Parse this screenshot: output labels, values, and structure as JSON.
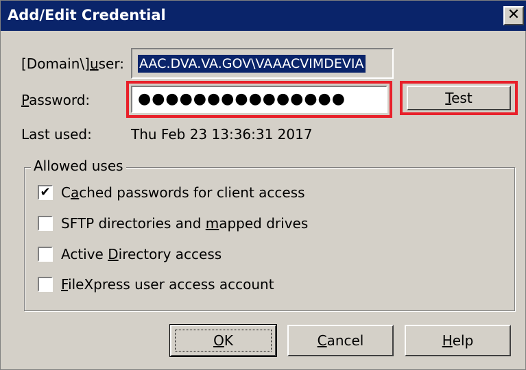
{
  "window": {
    "title": "Add/Edit Credential",
    "close_glyph": "✕"
  },
  "form": {
    "user_label_prefix": "[Domain\\]",
    "user_label_accel": "u",
    "user_label_suffix": "ser:",
    "user_value": "AAC.DVA.VA.GOV\\VAAACVIMDEVIA",
    "password_label_accel": "P",
    "password_label_suffix": "assword:",
    "password_value": "●●●●●●●●●●●●●●●",
    "test_accel": "T",
    "test_suffix": "est",
    "last_used_label": "Last used:",
    "last_used_value": "Thu Feb 23 13:36:31 2017"
  },
  "allowed_uses": {
    "legend": "Allowed uses",
    "items": [
      {
        "pre": "C",
        "accel": "a",
        "post": "ched passwords for client access",
        "checked": true,
        "mark": "✔"
      },
      {
        "pre": "SFTP directories and ",
        "accel": "m",
        "post": "apped drives",
        "checked": false,
        "mark": ""
      },
      {
        "pre": "Active ",
        "accel": "D",
        "post": "irectory access",
        "checked": false,
        "mark": ""
      },
      {
        "pre": "",
        "accel": "F",
        "post": "ileXpress user access account",
        "checked": false,
        "mark": ""
      }
    ]
  },
  "buttons": {
    "ok_accel": "O",
    "ok_suffix": "K",
    "cancel_accel": "C",
    "cancel_suffix": "ancel",
    "help_accel": "H",
    "help_suffix": "elp"
  },
  "colors": {
    "title_bar": "#0a246a",
    "dialog_bg": "#d4d0c8",
    "highlight_red": "#e8202a"
  }
}
